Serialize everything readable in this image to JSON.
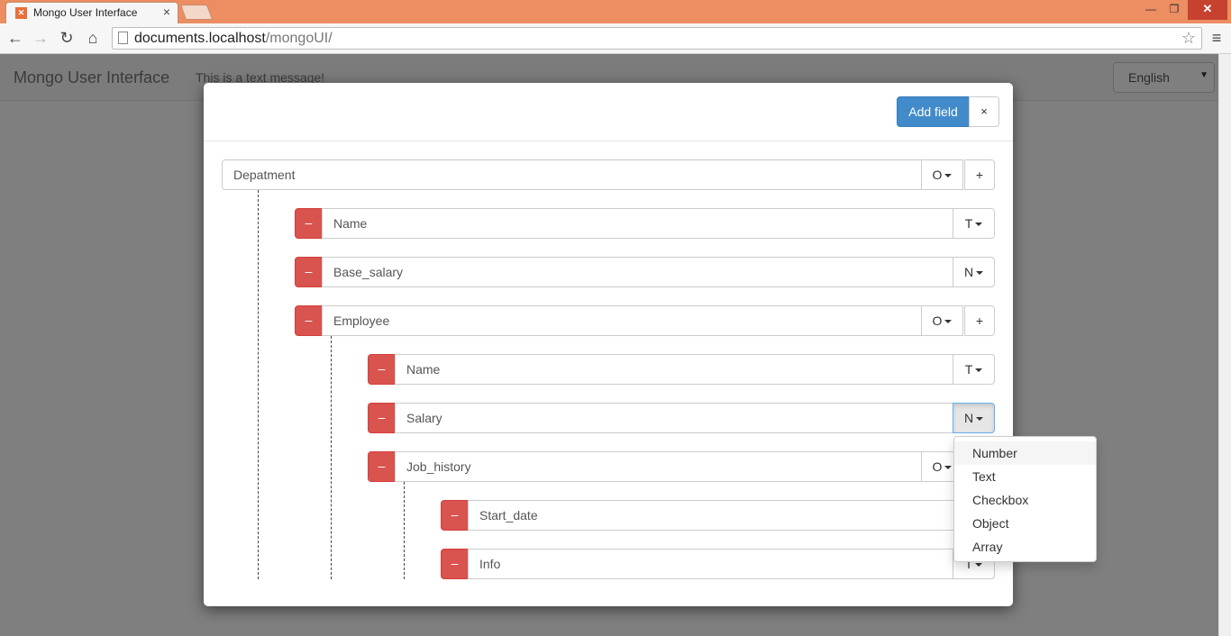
{
  "browser": {
    "tab_title": "Mongo User Interface",
    "url_host": "documents.localhost",
    "url_path": "/mongoUI/"
  },
  "navbar": {
    "brand": "Mongo User Interface",
    "message": "This is a text message!",
    "language": "English"
  },
  "modal": {
    "add_field_label": "Add field",
    "close_label": "×",
    "root": {
      "name": "Depatment",
      "type": "O",
      "plus": "+"
    },
    "fields": [
      {
        "name": "Name",
        "type": "T",
        "minus": "–"
      },
      {
        "name": "Base_salary",
        "type": "N",
        "minus": "–"
      },
      {
        "name": "Employee",
        "type": "O",
        "minus": "–",
        "plus": "+"
      },
      {
        "name": "Name",
        "type": "T",
        "minus": "–"
      },
      {
        "name": "Salary",
        "type": "N",
        "minus": "–"
      },
      {
        "name": "Job_history",
        "type": "O",
        "minus": "–"
      },
      {
        "name": "Start_date",
        "type": "",
        "minus": "–"
      },
      {
        "name": "Info",
        "type": "T",
        "minus": "–"
      }
    ]
  },
  "dropdown": {
    "options": [
      "Number",
      "Text",
      "Checkbox",
      "Object",
      "Array"
    ],
    "highlighted": "Number"
  }
}
